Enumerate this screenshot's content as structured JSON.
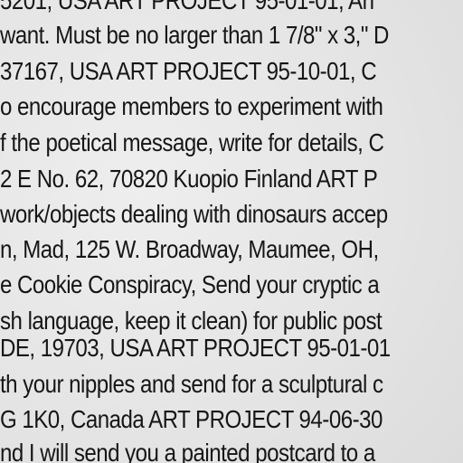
{
  "document": {
    "lines": [
      "5201, USA ART PROJECT 95-01-01, An",
      "want. Must be no larger than 1 7/8\" x 3,\" D",
      "37167, USA ART PROJECT 95-10-01, C",
      "o encourage members to experiment with",
      "f the poetical message, write for details, C",
      " 2 E No. 62, 70820 Kuopio Finland ART P",
      "work/objects dealing with dinosaurs accep",
      "n, Mad, 125 W. Broadway, Maumee, OH,",
      "e Cookie Conspiracy, Send your cryptic a",
      "sh language, keep it clean) for public post",
      "DE, 19703, USA ART PROJECT 95-01-01",
      "th your nipples and send for a sculptural c",
      "G 1K0, Canada ART PROJECT 94-06-30",
      "nd I will send you a painted postcard to a"
    ]
  }
}
